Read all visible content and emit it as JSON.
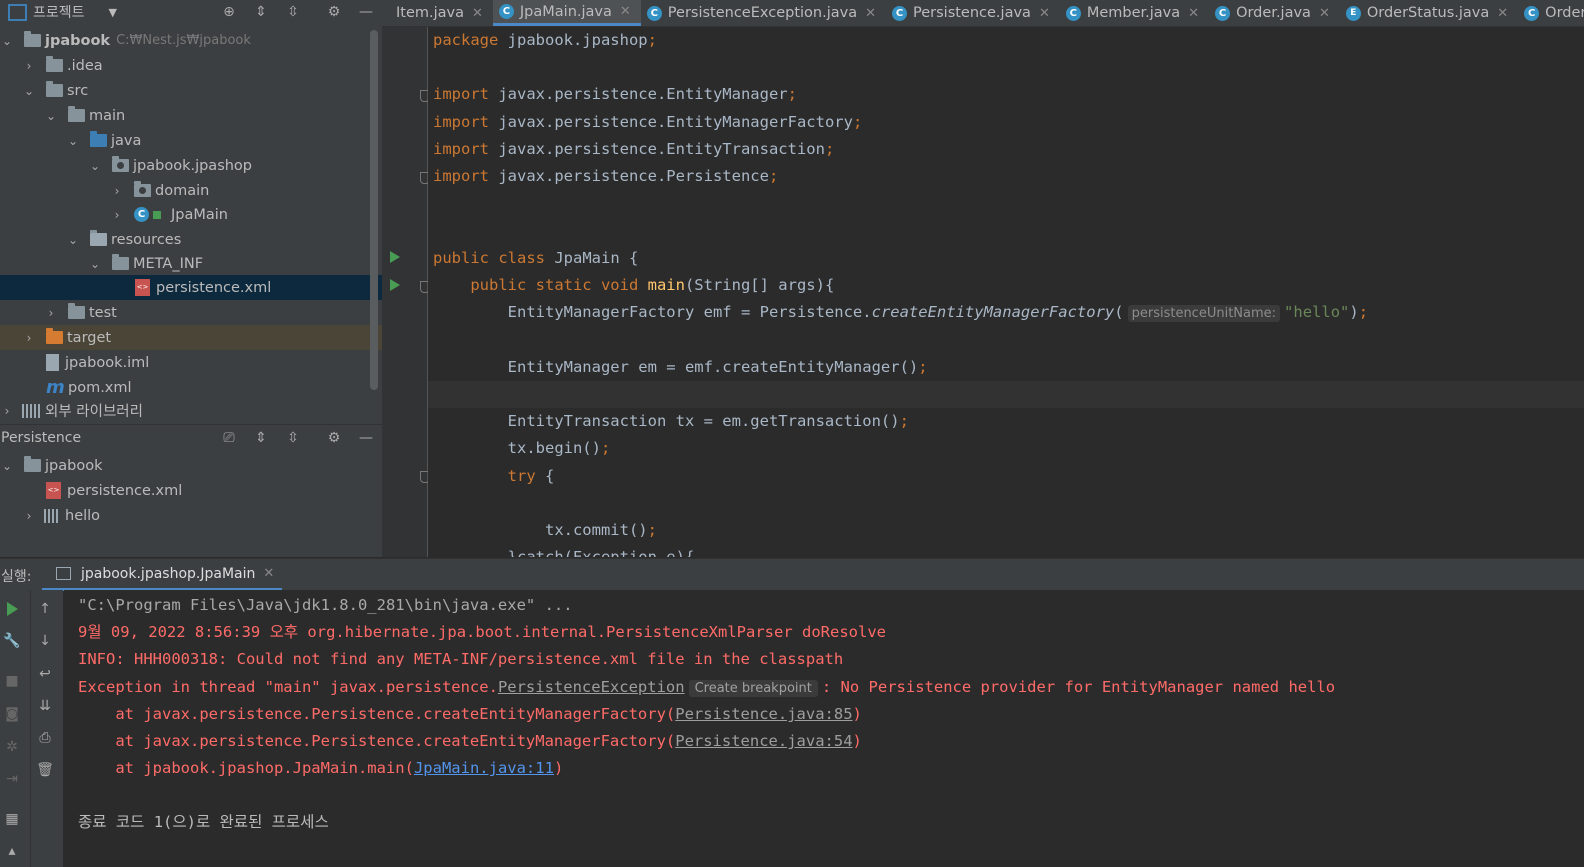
{
  "project_panel": {
    "title": "프로젝트",
    "tree": [
      {
        "label": "jpabook",
        "path": "C:₩Nest.js₩jpabook"
      },
      {
        "label": ".idea"
      },
      {
        "label": "src"
      },
      {
        "label": "main"
      },
      {
        "label": "java"
      },
      {
        "label": "jpabook.jpashop"
      },
      {
        "label": "domain"
      },
      {
        "label": "JpaMain"
      },
      {
        "label": "resources"
      },
      {
        "label": "META_INF"
      },
      {
        "label": "persistence.xml"
      },
      {
        "label": "test"
      },
      {
        "label": "target"
      },
      {
        "label": "jpabook.iml"
      },
      {
        "label": "pom.xml"
      },
      {
        "label": "외부 라이브러리"
      }
    ]
  },
  "persistence_panel": {
    "title": "Persistence",
    "tree": [
      {
        "label": "jpabook"
      },
      {
        "label": "persistence.xml"
      },
      {
        "label": "hello"
      }
    ]
  },
  "tabs": [
    {
      "label": "Item.java"
    },
    {
      "label": "JpaMain.java",
      "active": true
    },
    {
      "label": "PersistenceException.java"
    },
    {
      "label": "Persistence.java"
    },
    {
      "label": "Member.java"
    },
    {
      "label": "Order.java"
    },
    {
      "label": "OrderStatus.java"
    },
    {
      "label": "OrderI"
    }
  ],
  "code": {
    "l1_pkg": "jpabook.jpashop",
    "imp1": "javax.persistence.EntityManager",
    "imp2": "javax.persistence.EntityManagerFactory",
    "imp3": "javax.persistence.EntityTransaction",
    "imp4": "javax.persistence.Persistence",
    "class_name": "JpaMain",
    "main_sig": "(String[] args){",
    "emf_left": "EntityManagerFactory emf = Persistence.",
    "emf_method": "createEntityManagerFactory",
    "emf_hint": "persistenceUnitName:",
    "emf_arg": "\"hello\"",
    "em_line": "EntityManager em = emf.createEntityManager()",
    "tx_line": "EntityTransaction tx = em.getTransaction()",
    "begin_line": "tx.begin()",
    "commit_line": "tx.commit()",
    "catch_line": "}catch(Exception e){"
  },
  "run": {
    "label": "실행:",
    "tab": "jpabook.jpashop.JpaMain",
    "console": {
      "cmd": "\"C:\\Program Files\\Java\\jdk1.8.0_281\\bin\\java.exe\" ...",
      "log1": "9월 09, 2022 8:56:39 오후 org.hibernate.jpa.boot.internal.PersistenceXmlParser doResolve",
      "log2": "INFO: HHH000318: Could not find any META-INF/persistence.xml file in the classpath",
      "exc_prefix": "Exception in thread \"main\" javax.persistence.",
      "exc_link": "PersistenceException",
      "exc_hint": "Create breakpoint",
      "exc_suffix": ": No Persistence provider for EntityManager named hello",
      "at1_prefix": "    at javax.persistence.Persistence.createEntityManagerFactory(",
      "at1_link": "Persistence.java:85",
      "at2_prefix": "    at javax.persistence.Persistence.createEntityManagerFactory(",
      "at2_link": "Persistence.java:54",
      "at3_prefix": "    at jpabook.jpashop.JpaMain.main(",
      "at3_link": "JpaMain.java:11",
      "exit": "종료 코드 1(으)로 완료된 프로세스"
    }
  }
}
